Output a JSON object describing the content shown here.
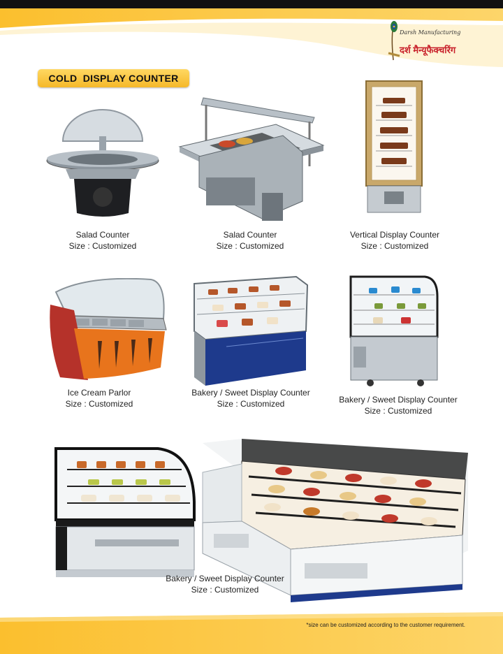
{
  "brand": {
    "name_script": "Darsh Manufacturing",
    "name_hindi": "दर्श मैन्यूफैक्चरिंग"
  },
  "section_title": "COLD  DISPLAY COUNTER",
  "products": [
    {
      "name": "Salad Counter",
      "size": "Size : Customized"
    },
    {
      "name": "Salad Counter",
      "size": "Size : Customized"
    },
    {
      "name": "Vertical Display Counter",
      "size": "Size : Customized"
    },
    {
      "name": "Ice Cream Parlor",
      "size": "Size : Customized"
    },
    {
      "name": "Bakery / Sweet Display Counter",
      "size": "Size : Customized"
    },
    {
      "name": "Bakery / Sweet Display Counter",
      "size": "Size : Customized"
    },
    {
      "name": "Bakery / Sweet Display Counter",
      "size": "Size : Customized"
    }
  ],
  "footnote": "*size can be customized according to the customer requirement.",
  "colors": {
    "accent": "#f5b829",
    "accent_light": "#ffd862",
    "logo_red": "#c8202a"
  }
}
